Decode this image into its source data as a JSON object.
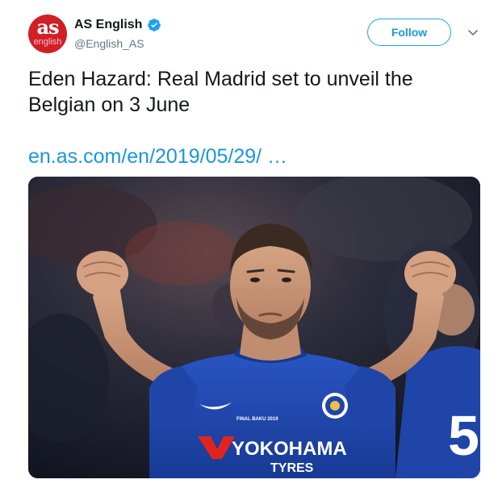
{
  "author": {
    "avatar_text": "as",
    "avatar_subtext": "english",
    "display_name": "AS English",
    "handle": "@English_AS",
    "verified": true
  },
  "actions": {
    "follow_label": "Follow",
    "menu_icon": "chevron-down-icon"
  },
  "tweet": {
    "text": "Eden Hazard: Real Madrid set to unveil the Belgian on 3 June",
    "link": "en.as.com/en/2019/05/29/ …"
  },
  "media": {
    "shirt_sponsor_line1": "YOKOHAMA",
    "shirt_sponsor_line2": "TYRES",
    "badge_text": "FINAL BAKU 2019",
    "player_number": "5"
  },
  "colors": {
    "accent": "#1da1f2",
    "link": "#1b95e0",
    "handle": "#657786",
    "avatar_bg": "#d11f26",
    "kit_blue": "#1f45a8"
  }
}
